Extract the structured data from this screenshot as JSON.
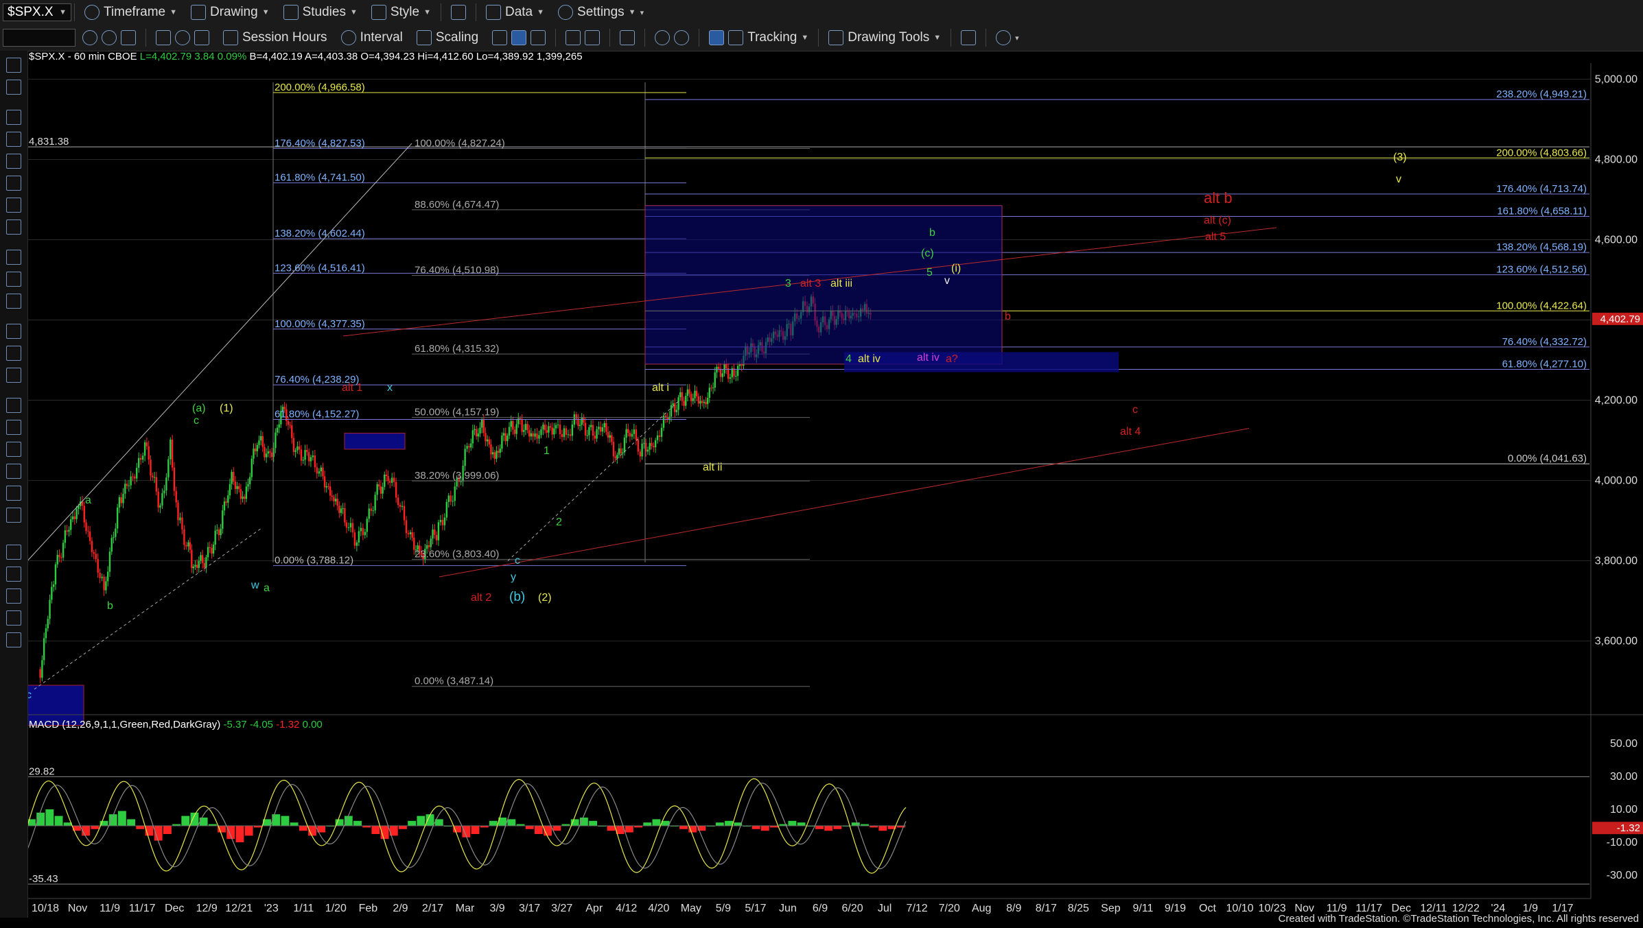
{
  "toolbar": {
    "symbol": "$SPX.X",
    "timeframe": "Timeframe",
    "drawing": "Drawing",
    "studies": "Studies",
    "style": "Style",
    "data": "Data",
    "settings": "Settings",
    "session_hours": "Session Hours",
    "interval": "Interval",
    "scaling": "Scaling",
    "tracking": "Tracking",
    "drawing_tools": "Drawing Tools"
  },
  "header": {
    "symbol": "$SPX.X - 60 min",
    "exchange": "CBOE",
    "last": "L=4,402.79",
    "change": "3.84",
    "change_pct": "0.09%",
    "bid": "B=4,402.19",
    "ask": "A=4,403.38",
    "open": "O=4,394.23",
    "high": "Hi=4,412.60",
    "low": "Lo=4,389.92",
    "volume": "1,399,265"
  },
  "macd_header": {
    "label": "MACD (12,26,9,1,1,Green,Red,DarkGray)",
    "v1": "-5.37",
    "v2": "-4.05",
    "v3": "-1.32",
    "v4": "0.00"
  },
  "footer": "Created with TradeStation. ©TradeStation Technologies, Inc. All rights reserved",
  "colors": {
    "up": "#2ecc40",
    "down": "#ff2222",
    "yellow": "#e8e84a",
    "red": "#d42020",
    "cyan": "#3fc7e0",
    "green": "#3fd13f",
    "magenta": "#d040d0",
    "blue_box": "#0a0a80"
  },
  "chart_data": [
    {
      "type": "candlestick",
      "title": "$SPX.X - 60 min",
      "x_dates": [
        "10/18",
        "Nov",
        "11/9",
        "11/17",
        "Dec",
        "12/9",
        "12/21",
        "'23",
        "1/11",
        "1/20",
        "Feb",
        "2/9",
        "2/17",
        "Mar",
        "3/9",
        "3/17",
        "3/27",
        "Apr",
        "4/12",
        "4/20",
        "May",
        "5/9",
        "5/17",
        "Jun",
        "6/9",
        "6/20",
        "Jul",
        "7/12",
        "7/20",
        "Aug",
        "8/9",
        "8/17",
        "8/25",
        "Sep",
        "9/11",
        "9/19",
        "Oct",
        "10/10",
        "10/23",
        "Nov",
        "11/9",
        "11/17",
        "Dec",
        "12/11",
        "12/22",
        "'24",
        "1/9",
        "1/17"
      ],
      "ylim": [
        3420,
        5040
      ],
      "y_ticks": [
        "5,000.00",
        "4,800.00",
        "4,600.00",
        "4,400.00",
        "4,200.00",
        "4,000.00",
        "3,800.00",
        "3,600.00"
      ],
      "last_price_label": "4,402.79",
      "path": [
        [
          10,
          3530
        ],
        [
          22,
          3790
        ],
        [
          40,
          3950
        ],
        [
          52,
          3820
        ],
        [
          60,
          3720
        ],
        [
          72,
          3960
        ],
        [
          84,
          4010
        ],
        [
          92,
          4100
        ],
        [
          104,
          3920
        ],
        [
          112,
          4080
        ],
        [
          118,
          3900
        ],
        [
          126,
          3830
        ],
        [
          130,
          3780
        ],
        [
          140,
          3810
        ],
        [
          150,
          3880
        ],
        [
          160,
          4000
        ],
        [
          170,
          3960
        ],
        [
          180,
          4100
        ],
        [
          190,
          4060
        ],
        [
          200,
          4180
        ],
        [
          210,
          4080
        ],
        [
          222,
          4050
        ],
        [
          230,
          4010
        ],
        [
          240,
          3960
        ],
        [
          250,
          3890
        ],
        [
          258,
          3850
        ],
        [
          266,
          3900
        ],
        [
          274,
          3980
        ],
        [
          284,
          4010
        ],
        [
          292,
          3930
        ],
        [
          300,
          3850
        ],
        [
          310,
          3820
        ],
        [
          322,
          3880
        ],
        [
          330,
          3950
        ],
        [
          338,
          4000
        ],
        [
          346,
          4100
        ],
        [
          356,
          4130
        ],
        [
          366,
          4060
        ],
        [
          376,
          4120
        ],
        [
          386,
          4150
        ],
        [
          396,
          4100
        ],
        [
          404,
          4120
        ],
        [
          414,
          4140
        ],
        [
          422,
          4110
        ],
        [
          430,
          4150
        ],
        [
          440,
          4120
        ],
        [
          452,
          4130
        ],
        [
          462,
          4060
        ],
        [
          472,
          4130
        ],
        [
          480,
          4070
        ],
        [
          492,
          4100
        ],
        [
          500,
          4150
        ],
        [
          510,
          4200
        ],
        [
          520,
          4220
        ],
        [
          530,
          4180
        ],
        [
          540,
          4280
        ],
        [
          552,
          4260
        ],
        [
          564,
          4320
        ],
        [
          574,
          4330
        ],
        [
          586,
          4360
        ],
        [
          598,
          4380
        ],
        [
          606,
          4420
        ],
        [
          614,
          4440
        ],
        [
          620,
          4380
        ],
        [
          628,
          4400
        ],
        [
          638,
          4420
        ],
        [
          648,
          4400
        ],
        [
          656,
          4430
        ],
        [
          662,
          4400
        ]
      ],
      "fib_levels_left": [
        {
          "label": "200.00% (4,966.58)",
          "value": 4966.58
        },
        {
          "label": "176.40% (4,827.53)",
          "value": 4827.53
        },
        {
          "label": "161.80% (4,741.50)",
          "value": 4741.5
        },
        {
          "label": "138.20% (4,602.44)",
          "value": 4602.44
        },
        {
          "label": "123.60% (4,516.41)",
          "value": 4516.41
        },
        {
          "label": "100.00% (4,377.35)",
          "value": 4377.35
        },
        {
          "label": "76.40% (4,238.29)",
          "value": 4238.29
        },
        {
          "label": "61.80% (4,152.27)",
          "value": 4152.27
        },
        {
          "label": "0.00% (3,788.12)",
          "value": 3788.12
        }
      ],
      "fib_levels_mid": [
        {
          "label": "100.00% (4,827.24)",
          "value": 4827.24
        },
        {
          "label": "88.60% (4,674.47)",
          "value": 4674.47
        },
        {
          "label": "76.40% (4,510.98)",
          "value": 4510.98
        },
        {
          "label": "61.80% (4,315.32)",
          "value": 4315.32
        },
        {
          "label": "50.00% (4,157.19)",
          "value": 4157.19
        },
        {
          "label": "38.20% (3,999.06)",
          "value": 3999.06
        },
        {
          "label": "23.60% (3,803.40)",
          "value": 3803.4
        },
        {
          "label": "0.00% (3,487.14)",
          "value": 3487.14
        }
      ],
      "fib_levels_right": [
        {
          "label": "238.20% (4,949.21)",
          "value": 4949.21
        },
        {
          "label": "200.00% (4,803.66)",
          "value": 4803.66
        },
        {
          "label": "176.40% (4,713.74)",
          "value": 4713.74
        },
        {
          "label": "161.80% (4,658.11)",
          "value": 4658.11
        },
        {
          "label": "138.20% (4,568.19)",
          "value": 4568.19
        },
        {
          "label": "123.60% (4,512.56)",
          "value": 4512.56
        },
        {
          "label": "100.00% (4,422.64)",
          "value": 4422.64
        },
        {
          "label": "76.40% (4,332.72)",
          "value": 4332.72
        },
        {
          "label": "61.80% (4,277.10)",
          "value": 4277.1
        },
        {
          "label": "0.00% (4,041.63)",
          "value": 4041.63
        }
      ],
      "price_label_left": {
        "label": "4,831.38",
        "value": 4831.38
      },
      "wave_labels": [
        {
          "text": "(a)",
          "color": "green"
        },
        {
          "text": "(1)",
          "color": "yellow"
        },
        {
          "text": "c",
          "color": "green"
        },
        {
          "text": "a",
          "color": "green"
        },
        {
          "text": "b",
          "color": "green"
        },
        {
          "text": "w",
          "color": "cyan"
        },
        {
          "text": "a",
          "color": "green"
        },
        {
          "text": "x",
          "color": "cyan"
        },
        {
          "text": "alt 1",
          "color": "red"
        },
        {
          "text": "alt 2",
          "color": "red"
        },
        {
          "text": "c",
          "color": "cyan"
        },
        {
          "text": "y",
          "color": "cyan"
        },
        {
          "text": "(b)",
          "color": "cyan"
        },
        {
          "text": "(2)",
          "color": "yellow"
        },
        {
          "text": "1",
          "color": "green"
        },
        {
          "text": "2",
          "color": "green"
        },
        {
          "text": "alt i",
          "color": "yellow"
        },
        {
          "text": "alt ii",
          "color": "yellow"
        },
        {
          "text": "3",
          "color": "green"
        },
        {
          "text": "alt 3",
          "color": "red"
        },
        {
          "text": "alt iii",
          "color": "yellow"
        },
        {
          "text": "4",
          "color": "green"
        },
        {
          "text": "alt iv",
          "color": "yellow"
        },
        {
          "text": "alt iv",
          "color": "magenta"
        },
        {
          "text": "a?",
          "color": "red"
        },
        {
          "text": "5",
          "color": "green"
        },
        {
          "text": "(c)",
          "color": "green"
        },
        {
          "text": "b",
          "color": "green"
        },
        {
          "text": "(i)",
          "color": "yellow"
        },
        {
          "text": "v",
          "color": "white"
        },
        {
          "text": "b",
          "color": "red"
        },
        {
          "text": "alt b",
          "color": "red"
        },
        {
          "text": "alt (c)",
          "color": "red"
        },
        {
          "text": "alt 5",
          "color": "red"
        },
        {
          "text": "c",
          "color": "red"
        },
        {
          "text": "alt 4",
          "color": "red"
        },
        {
          "text": "(3)",
          "color": "yellow"
        },
        {
          "text": "v",
          "color": "yellow"
        },
        {
          "text": "c",
          "color": "cyan"
        }
      ]
    },
    {
      "type": "bar",
      "title": "MACD (12,26,9,1,1,Green,Red,DarkGray)",
      "ylim": [
        -40,
        60
      ],
      "y_ticks": [
        "50.00",
        "30.00",
        "10.00",
        "-10.00",
        "-30.00"
      ],
      "level_labels": [
        {
          "label": "29.82",
          "value": 29.82
        },
        {
          "label": "-35.43",
          "value": -35.43
        }
      ],
      "current_label": "-1.32",
      "histogram_values": [
        4,
        8,
        10,
        6,
        2,
        -3,
        -6,
        -2,
        3,
        7,
        9,
        4,
        -2,
        -6,
        -9,
        -5,
        1,
        6,
        8,
        5,
        1,
        -4,
        -8,
        -10,
        -6,
        -1,
        4,
        7,
        6,
        2,
        -3,
        -6,
        -4,
        0,
        4,
        6,
        3,
        -1,
        -5,
        -8,
        -6,
        -2,
        3,
        6,
        7,
        4,
        0,
        -4,
        -7,
        -5,
        -1,
        3,
        5,
        4,
        1,
        -2,
        -5,
        -6,
        -3,
        1,
        4,
        5,
        3,
        0,
        -3,
        -5,
        -4,
        -1,
        2,
        4,
        3,
        0,
        -2,
        -4,
        -3,
        0,
        2,
        3,
        2,
        0,
        -2,
        -3,
        -1,
        1,
        3,
        2,
        0,
        -2,
        -3,
        -2,
        0,
        2,
        1,
        -1,
        -3,
        -2,
        -1
      ]
    }
  ]
}
